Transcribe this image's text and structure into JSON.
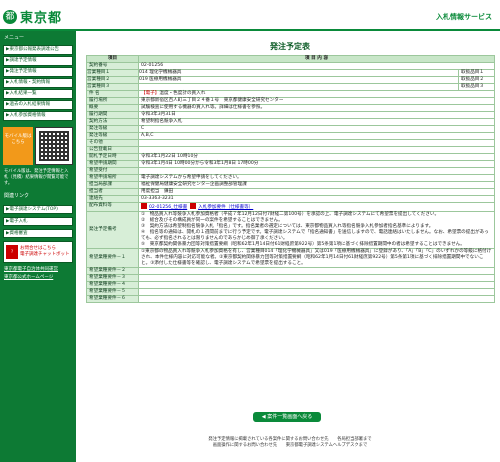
{
  "header": {
    "logo_mark": "都",
    "logo_text": "東京都",
    "right_title": "入札情報サービス"
  },
  "sidebar": {
    "menu_head": "メニュー",
    "items": [
      "▶東京都公報発表調達公告",
      "▶調達予定情報",
      "▶発注予定情報",
      "▶入札情報・契約情報",
      "▶入札結果一覧",
      "▶過去の入札結果情報",
      "▶入札参加資格情報"
    ],
    "mobile_label": "モバイル版はこちら",
    "mobile_note": "モバイル版は、発注予定情報と入札（見積）結果情報が閲覧可能です。",
    "links_head": "関連リンク",
    "sub_items": [
      "▶電子調達システム(TOP)",
      "▶電子入札",
      "▶資格審査"
    ],
    "pdf_text_1": "お問合せはこちら",
    "pdf_text_2": "電子調達チャットボット",
    "bottom_links": [
      "東京都電子自治体共同運営",
      "東京都公式ホームページ"
    ]
  },
  "main": {
    "page_title": "発注予定表",
    "col_item": "項目",
    "col_content": "項 目 内 容",
    "rows": [
      {
        "label": "契約番号",
        "value": "02-01256"
      },
      {
        "label": "件 名",
        "tag": "【電子】",
        "value": "温度・色度計の買入れ"
      },
      {
        "label": "履行場所",
        "value": "東京都新宿区百人町三丁目２４番１号　東京都健康安全研究センター"
      },
      {
        "label": "概要",
        "value": "試験検査に使用する機器の買入れ等。詳細は仕様書を参照。"
      },
      {
        "label": "履行期間",
        "value": "令和3年3月31日"
      },
      {
        "label": "契約方法",
        "value": "希望制指名競争入札"
      },
      {
        "label": "発注等級",
        "value": "C"
      },
      {
        "label": "発注等級",
        "value": "A,B,C"
      },
      {
        "label": "その他",
        "value": ""
      },
      {
        "label": "公告登載日",
        "value": ""
      },
      {
        "label": "開札予定日時",
        "value": "令和3年1月22日 10時10分"
      },
      {
        "label": "希望申請期間",
        "value": "令和3年1月4日 10時00分から令和3年1月8日 17時00分"
      },
      {
        "label": "希望受付",
        "value": ""
      },
      {
        "label": "希望申請場所",
        "value": "電子調達システムから希望申請をしてください。"
      },
      {
        "label": "担当局部課",
        "value": "福祉保健局健康安全研究センター企画調整部管理課"
      },
      {
        "label": "担当者",
        "value": "用度担当　鎌田"
      },
      {
        "label": "連絡先",
        "value": "03-3363-3231"
      }
    ],
    "types": [
      {
        "label": "営業種目１",
        "value": "014 理化学機械器具",
        "level_label": "取扱品目１",
        "level": ""
      },
      {
        "label": "営業種目２",
        "value": "019 医療用機械器具",
        "level_label": "取扱品目２",
        "level": ""
      },
      {
        "label": "営業種目３",
        "value": "",
        "level_label": "取扱品目３",
        "level": ""
      }
    ],
    "attachments_label": "配布資料等",
    "attachments": [
      "02-01256_仕様書",
      "入札参加要件（仕様書等）"
    ],
    "notes_label": "発注予定備考",
    "notes": [
      "①　物品買入れ等競争入札参加資格者（平成７年12月12日付7財経二第100号）を承認の上、電子調達システムにて希望票を提出してください。",
      "②　総合及びその構成員が同一の案件を希望することはできません。",
      "③　契約方法は希望制指名競争入札「指名」です。指名業者の選定については、東京都物品買入れ等指名競争入札参加者指名基準によります。",
      "④　指名等の通知は、開札の１週間前までに行う予定です。電子調達システムで「指名通知書」を送信しますので、電話連絡はいたしません。なお、希望票の提出があっても、必ず指名されるとは限りませんのであらかじめ御了承ください。",
      "⑤　東京都契約関係暴力団等対策措置要綱（昭和62年1月14日付61財経庶第922号）第5条第1項に基づく排除措置期間中の者は希望することはできません。"
    ],
    "req_label": "希望業種要件－１",
    "requirement": "①東京都の物品買入れ等競争入札参加資格を有し、営業種目014「理化学機械器具」又は019「医療用機械器具」に登録があり、「A」「B」「C」のいずれかの等級に格付けされ、本件仕様内容に対応可能な者。②東京都契約関係暴力団等対策措置要綱（昭和62年1月14日付61財経庶第922号）第5条第1項に基づく排除措置期間中でないこと。③添付した仕様書等を確認し、電子調達システムで希望票を提出すること。",
    "more_reqs": [
      "希望業種要件－２",
      "希望業種要件－３",
      "希望業種要件－４",
      "希望業種要件－５",
      "希望業種要件－６"
    ],
    "back_label": "◀ 案件一覧画面へ戻る"
  },
  "footer": {
    "line1": "発注予定情報に掲載されている各案件に関するお問い合わせ先　　各局担当部署まで",
    "line2": "画面操作に関するお問い合わせ先　　東京都電子調達システムヘルプデスクまで"
  },
  "colors": {
    "brand_green": "#0a8a3a",
    "sidebar_green": "#0d7a34",
    "label_bg": "#d7eed7",
    "tag_red": "#cc0000"
  }
}
